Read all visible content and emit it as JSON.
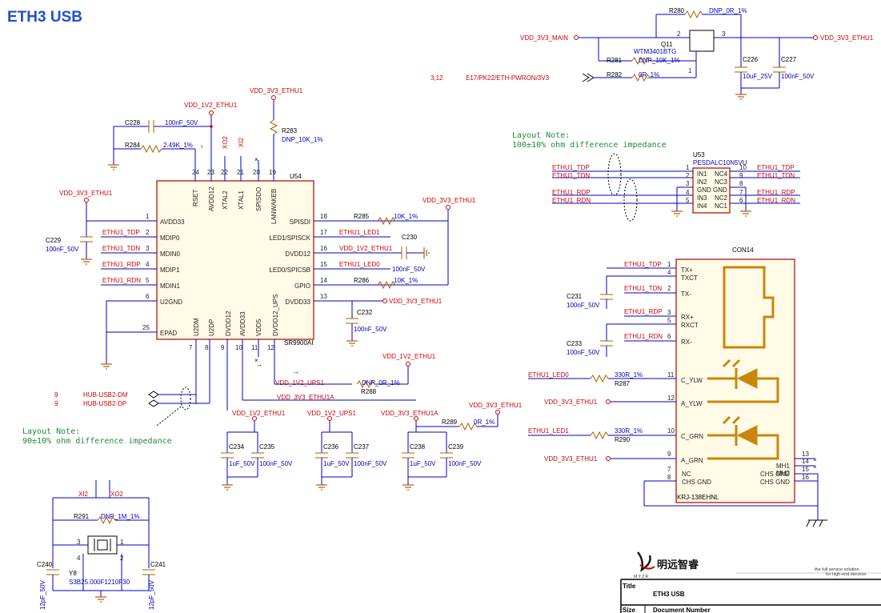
{
  "title": "ETH3 USB",
  "u54": {
    "ref": "U54",
    "part": "SR9900AI",
    "top_pins": [
      {
        "num": "24",
        "name": "RSET"
      },
      {
        "num": "23",
        "name": "AVDD12"
      },
      {
        "num": "22",
        "name": "XTAL2"
      },
      {
        "num": "21",
        "name": "XTAL1"
      },
      {
        "num": "20",
        "name": "SPISDO"
      },
      {
        "num": "19",
        "name": "LANWAKEB"
      }
    ],
    "left_pins": [
      {
        "num": "1",
        "name": "AVDD33"
      },
      {
        "num": "2",
        "name": "MDIP0"
      },
      {
        "num": "3",
        "name": "MDIN0"
      },
      {
        "num": "4",
        "name": "MDIP1"
      },
      {
        "num": "5",
        "name": "MDIN1"
      },
      {
        "num": "6",
        "name": "U2GND"
      },
      {
        "num": "25",
        "name": "EPAD"
      }
    ],
    "right_pins": [
      {
        "num": "18",
        "name": "SPISDI"
      },
      {
        "num": "17",
        "name": "LED1/SPISCK"
      },
      {
        "num": "16",
        "name": "DVDD12"
      },
      {
        "num": "15",
        "name": "LED0/SPICSB"
      },
      {
        "num": "14",
        "name": "GPIO"
      },
      {
        "num": "13",
        "name": "DVDD33"
      }
    ],
    "bottom_pins": [
      {
        "num": "7",
        "name": "U2DM"
      },
      {
        "num": "8",
        "name": "U2DP"
      },
      {
        "num": "9",
        "name": "DVDD12"
      },
      {
        "num": "10",
        "name": "AVDD33"
      },
      {
        "num": "11",
        "name": "VDD5"
      },
      {
        "num": "12",
        "name": "DVDD12_UPS"
      }
    ]
  },
  "nets": {
    "vdd_1v2_ethu1": "VDD_1V2_ETHU1",
    "vdd_3v3_ethu1": "VDD_3V3_ETHU1",
    "vdd_3v3_main": "VDD_3V3_MAIN",
    "vdd_1v2_ups1": "VDD_1V2_UPS1",
    "vdd_3v3_ethu1a": "VDD_3V3_ETHU1A",
    "ethu1_tdp": "ETHU1_TDP",
    "ethu1_tdn": "ETHU1_TDN",
    "ethu1_rdp": "ETHU1_RDP",
    "ethu1_rdn": "ETHU1_RDN",
    "ethu1_led0": "ETHU1_LED0",
    "ethu1_led1": "ETHU1_LED1",
    "xo2": "XO2",
    "xi2": "XI2",
    "hub_dm": "HUB-USB2-DM",
    "hub_dp": "HUB-USB2-DP",
    "hub_page": "9",
    "pwron": "E17/PK22/ETH-PWRON/3V3",
    "pwron_page": "3,12"
  },
  "parts": {
    "r280": {
      "ref": "R280",
      "val": "DNP_0R_1%"
    },
    "r281": {
      "ref": "R281",
      "val": "DNP_10K_1%"
    },
    "r282": {
      "ref": "R282",
      "val": "0R_1%"
    },
    "q11": {
      "ref": "Q11",
      "part": "WTM3401BTG",
      "p2": "2",
      "p3": "3",
      "p1": "1"
    },
    "c226": {
      "ref": "C226",
      "val": "10uF_25V"
    },
    "c227": {
      "ref": "C227",
      "val": "100nF_50V"
    },
    "c228": {
      "ref": "C228",
      "val": "100nF_50V"
    },
    "r284": {
      "ref": "R284",
      "val": "2.49K_1%"
    },
    "r283": {
      "ref": "R283",
      "val": "DNP_10K_1%"
    },
    "c229": {
      "ref": "C229",
      "val": "100nF_50V"
    },
    "r285": {
      "ref": "R285",
      "val": "10K_1%"
    },
    "c230": {
      "ref": "C230",
      "val": "100nF_50V"
    },
    "r286": {
      "ref": "R286",
      "val": "10K_1%"
    },
    "c232": {
      "ref": "C232",
      "val": "100nF_50V"
    },
    "r288": {
      "ref": "R288",
      "val": "DNP_0R_1%"
    },
    "c234": {
      "ref": "C234",
      "val": "1uF_50V"
    },
    "c235": {
      "ref": "C235",
      "val": "100nF_50V"
    },
    "c236": {
      "ref": "C236",
      "val": "1uF_50V"
    },
    "c237": {
      "ref": "C237",
      "val": "100nF_50V"
    },
    "c238": {
      "ref": "C238",
      "val": "1uF_50V"
    },
    "c239": {
      "ref": "C239",
      "val": "100nF_50V"
    },
    "r289": {
      "ref": "R289",
      "val": "0R_1%"
    },
    "r291": {
      "ref": "R291",
      "val": "DNP_1M_1%"
    },
    "y8": {
      "ref": "Y8",
      "part": "S3B25.000F1210F30",
      "p1": "1",
      "p2": "2",
      "p3": "3",
      "p4": "4"
    },
    "c240": {
      "ref": "C240",
      "val": "12pF_50V"
    },
    "c241": {
      "ref": "C241",
      "val": "12pF_50V"
    },
    "u53": {
      "ref": "U53",
      "part": "PESDALC10N5VU"
    },
    "c231": {
      "ref": "C231",
      "val": "100nF_50V"
    },
    "c233": {
      "ref": "C233",
      "val": "100nF_50V"
    },
    "r287": {
      "ref": "R287",
      "val": "330R_1%"
    },
    "r290": {
      "ref": "R290",
      "val": "330R_1%"
    },
    "con14": {
      "ref": "CON14",
      "part": "KRJ-138EHNL"
    }
  },
  "u53_pins": [
    {
      "l": "1",
      "ln": "IN1",
      "rn": "NC4",
      "r": "10"
    },
    {
      "l": "2",
      "ln": "IN2",
      "rn": "NC3",
      "r": "9"
    },
    {
      "l": "3",
      "ln": "GND",
      "rn": "GND",
      "r": "8"
    },
    {
      "l": "4",
      "ln": "IN3",
      "rn": "NC2",
      "r": "7"
    },
    {
      "l": "5",
      "ln": "IN4",
      "rn": "NC1",
      "r": "6"
    }
  ],
  "con14_pins": {
    "left": [
      {
        "n": "1",
        "s": "TX+"
      },
      {
        "n": "4",
        "s": "TXCT"
      },
      {
        "n": "2",
        "s": "TX-"
      },
      {
        "n": "3",
        "s": "RX+"
      },
      {
        "n": "5",
        "s": "RXCT"
      },
      {
        "n": "6",
        "s": "RX-"
      },
      {
        "n": "11",
        "s": "C_YLW"
      },
      {
        "n": "12",
        "s": "A_YLW"
      },
      {
        "n": "10",
        "s": "C_GRN"
      },
      {
        "n": "9",
        "s": "A_GRN"
      },
      {
        "n": "7",
        "s": "NC"
      },
      {
        "n": "8",
        "s": "CHS GND"
      }
    ],
    "right": [
      {
        "n": "13",
        "s": "MH1"
      },
      {
        "n": "14",
        "s": "MH2"
      },
      {
        "n": "15",
        "s": "CHS GND"
      },
      {
        "n": "16",
        "s": "CHS GND"
      }
    ]
  },
  "notes": {
    "n1_l1": "Layout Note:",
    "n1_l2": "100±10% ohm difference impedance",
    "n2_l1": "Layout Note:",
    "n2_l2": "90±10% ohm difference impedance"
  },
  "title_block": {
    "company": "明远智睿",
    "tagline_1": "the full service solution",
    "tagline_2": "for high-end electron",
    "logo_letters": "M Y Z R",
    "title_label": "Title",
    "title_value": "ETH3 USB",
    "size_label": "Size",
    "doc_label": "Document Number"
  },
  "misc": {
    "nc_mark": "×"
  }
}
